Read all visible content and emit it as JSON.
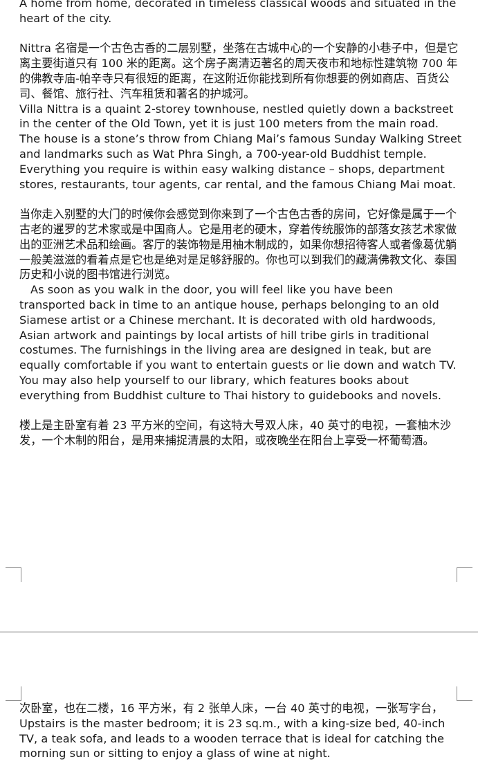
{
  "page1": {
    "p_intro": "A home from home, decorated in timeless classical woods and situated in the heart of the city.",
    "p_zh1": "Nittra 名宿是一个古色古香的二层别墅，坐落在古城中心的一个安静的小巷子中，但是它离主要街道只有 100 米的距离。这个房子离清迈著名的周天夜市和地标性建筑物 700 年的佛教寺庙-帕辛寺只有很短的距离，在这附近你能找到所有你想要的例如商店、百货公司、餐馆、旅行社、汽车租赁和著名的护城河。",
    "p_en1": "Villa Nittra is a quaint 2-storey townhouse, nestled quietly down a backstreet in the center of the Old Town, yet it is just 100 meters from the main road. The house is a stone’s throw from Chiang Mai’s famous Sunday Walking Street and landmarks such as Wat Phra Singh, a 700-year-old Buddhist temple. Everything you require is within easy walking distance – shops, department stores, restaurants, tour agents, car rental, and the famous Chiang Mai moat.",
    "p_zh2": "当你走入别墅的大门的时候你会感觉到你来到了一个古色古香的房间，它好像是属于一个古老的暹罗的艺术家或是中国商人。它是用老的硬木，穿着传统服饰的部落女孩艺术家做出的亚洲艺术品和绘画。客厅的装饰物是用柚木制成的，如果你想招待客人或者像葛优躺一般美滋滋的看着点是它也是绝对是足够舒服的。你也可以到我们的藏满佛教文化、泰国历史和小说的图书馆进行浏览。",
    "p_en2": "As soon as you walk in the door, you will feel like you have been transported back in time to an antique house, perhaps belonging to an old Siamese artist or a Chinese merchant. It is decorated with old hardwoods, Asian artwork and paintings by local artists of  hill tribe girls in traditional costumes. The furnishings in the living area are designed in teak, but are equally comfortable if you want to entertain guests or lie down and watch TV. You may also help yourself to our library, which features books about everything from Buddhist culture to Thai history to guidebooks and novels.",
    "p_zh3": "楼上是主卧室有着 23 平方米的空间，有这特大号双人床，40 英寸的电视，一套柚木沙发，一个木制的阳台，是用来捕捉清晨的太阳，或夜晚坐在阳台上享受一杯葡萄酒。"
  },
  "page2": {
    "p_zh4": "次卧室，也在二楼，16 平方米，有 2 张单人床，一台 40 英寸的电视，一张写字台，",
    "p_en4": "Upstairs is the master bedroom; it is 23 sq.m., with a king-size bed, 40-inch TV, a teak sofa, and leads to a wooden terrace that is ideal for catching the morning sun or sitting to enjoy a glass of wine at night."
  }
}
